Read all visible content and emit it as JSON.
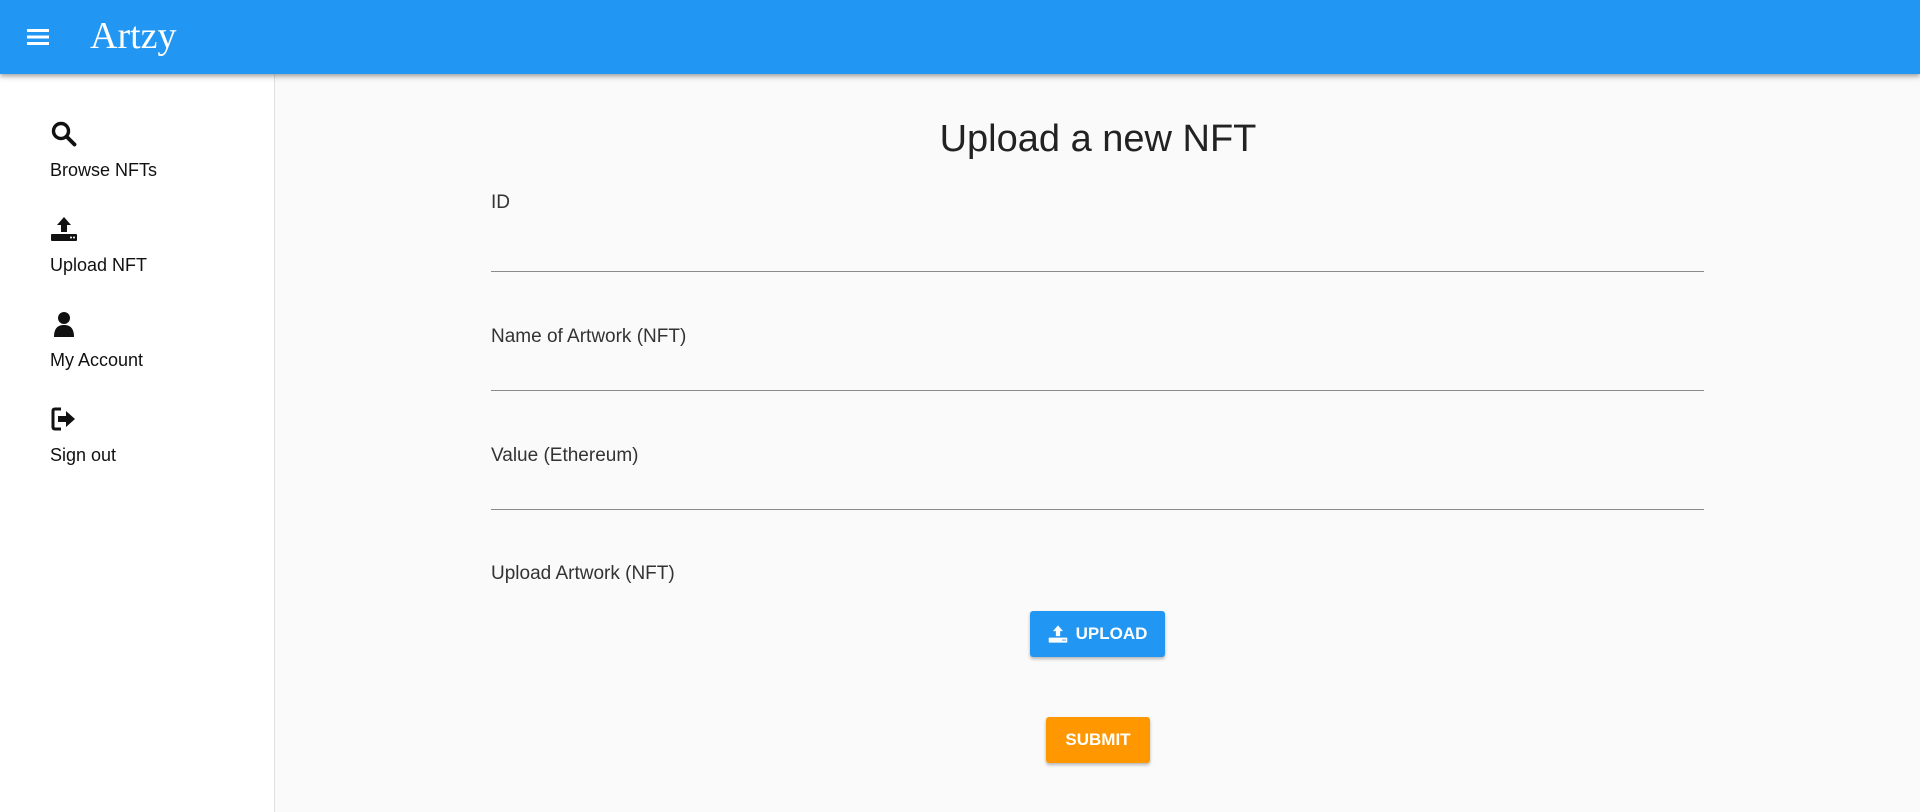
{
  "app": {
    "title": "Artzy"
  },
  "sidebar": {
    "items": [
      {
        "label": "Browse NFTs",
        "icon": "search-icon"
      },
      {
        "label": "Upload NFT",
        "icon": "upload-icon"
      },
      {
        "label": "My Account",
        "icon": "person-icon"
      },
      {
        "label": "Sign out",
        "icon": "sign-out-icon"
      }
    ]
  },
  "form": {
    "title": "Upload a new NFT",
    "fields": [
      {
        "label": "ID",
        "value": ""
      },
      {
        "label": "Name of Artwork (NFT)",
        "value": ""
      },
      {
        "label": "Value (Ethereum)",
        "value": ""
      }
    ],
    "upload_label": "Upload Artwork (NFT)",
    "upload_button": "UPLOAD",
    "submit_button": "SUBMIT"
  },
  "colors": {
    "primary": "#2196f3",
    "accent": "#ff9800",
    "background": "#fafafa"
  }
}
